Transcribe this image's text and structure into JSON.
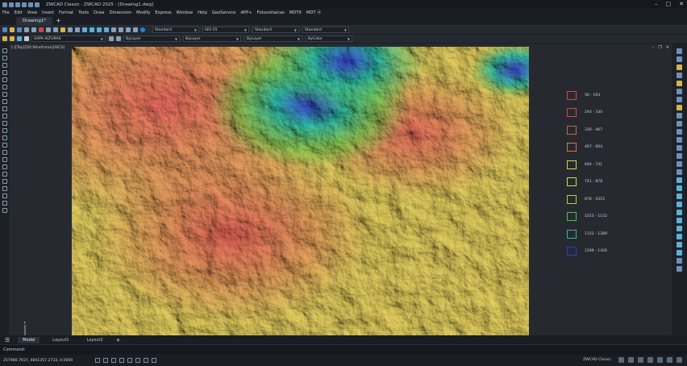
{
  "app": {
    "title": "ZWCAD Classic  ·  ZWCAD 2025 - [Drawing1.dwg]"
  },
  "menu": [
    "File",
    "Edit",
    "View",
    "Insert",
    "Format",
    "Tools",
    "Draw",
    "Dimension",
    "Modify",
    "Express",
    "Window",
    "Help",
    "GeoService",
    "APP+",
    "Fotovoltaicas",
    "MDT9",
    "MDT Ⓐ"
  ],
  "document_tab": "Drawing1*",
  "toolbar": {
    "layer": "SAPA ALTURAS",
    "color": "ByLayer",
    "linetype": "ByLayer",
    "lineweight": "ByLayer",
    "plotstyle": "ByColor",
    "text_style": "Standard",
    "dim_style": "ISO-25",
    "table_style": "Standard",
    "mleader_style": "Standard"
  },
  "viewport": {
    "label": "[-][Top][2D Wireframe][WCS]"
  },
  "legend": [
    {
      "label": "56 - 193",
      "color": "#e0443c"
    },
    {
      "label": "193 - 330",
      "color": "#d84a3c"
    },
    {
      "label": "330 - 467",
      "color": "#d0643a"
    },
    {
      "label": "467 - 604",
      "color": "#d67a3a"
    },
    {
      "label": "604 - 741",
      "color": "#e0d24a"
    },
    {
      "label": "741 - 878",
      "color": "#d8d84a"
    },
    {
      "label": "878 - 1015",
      "color": "#b4cc3e"
    },
    {
      "label": "1015 - 1152",
      "color": "#4ec04a"
    },
    {
      "label": "1152 - 1289",
      "color": "#2fb8a0"
    },
    {
      "label": "1289 - 1426",
      "color": "#2a3ccf"
    }
  ],
  "ucs": {
    "x": "X",
    "y": "Y"
  },
  "layout_tabs": [
    "Model",
    "Layout1",
    "Layout2"
  ],
  "command": {
    "label": "Command:"
  },
  "status": {
    "coords": "257980.7937, 4841357.2733, 0.0000",
    "workspace": "ZWCAD Classic"
  },
  "colors": {
    "accent": "#2e7bd6",
    "background": "#1f2329"
  }
}
